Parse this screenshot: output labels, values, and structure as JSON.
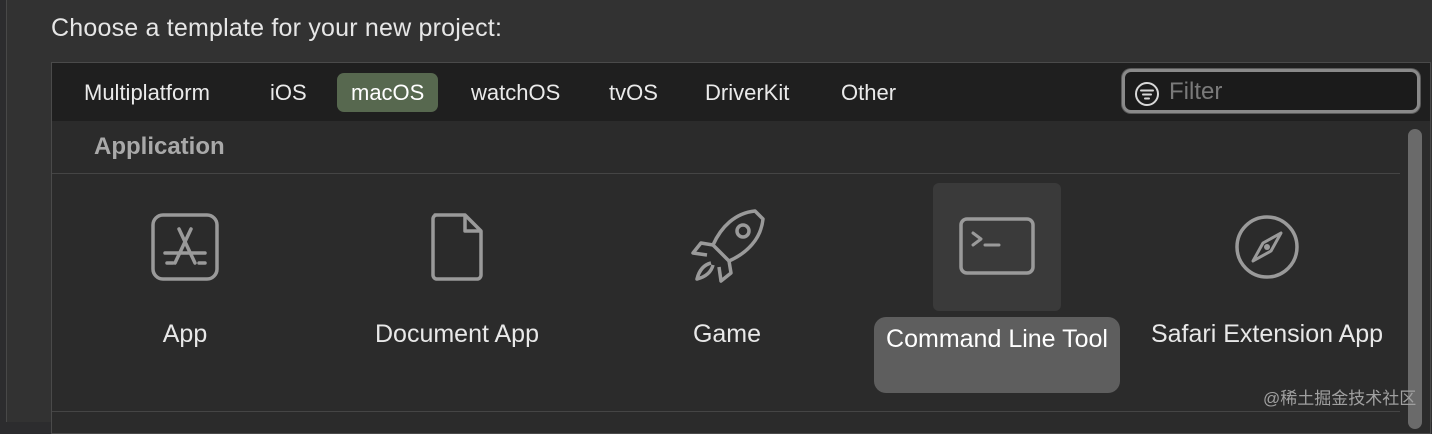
{
  "prompt": "Choose a template for your new project:",
  "tabs": [
    {
      "label": "Multiplatform",
      "selected": false
    },
    {
      "label": "iOS",
      "selected": false
    },
    {
      "label": "macOS",
      "selected": true
    },
    {
      "label": "watchOS",
      "selected": false
    },
    {
      "label": "tvOS",
      "selected": false
    },
    {
      "label": "DriverKit",
      "selected": false
    },
    {
      "label": "Other",
      "selected": false
    }
  ],
  "filter": {
    "placeholder": "Filter",
    "value": "",
    "icon": "filter-icon"
  },
  "section": {
    "title": "Application"
  },
  "templates": [
    {
      "label": "App",
      "icon": "app-store-icon",
      "selected": false
    },
    {
      "label": "Document App",
      "icon": "document-icon",
      "selected": false
    },
    {
      "label": "Game",
      "icon": "rocket-icon",
      "selected": false
    },
    {
      "label": "Command Line Tool",
      "icon": "terminal-icon",
      "selected": true
    },
    {
      "label": "Safari Extension App",
      "icon": "compass-icon",
      "selected": false
    }
  ],
  "colors": {
    "selected_tab": "#57684f",
    "selected_tile_label": "#5e5e5e",
    "tab_bar": "#1f1f1f",
    "panel": "#2b2b2b"
  },
  "watermark": "@稀土掘金技术社区"
}
